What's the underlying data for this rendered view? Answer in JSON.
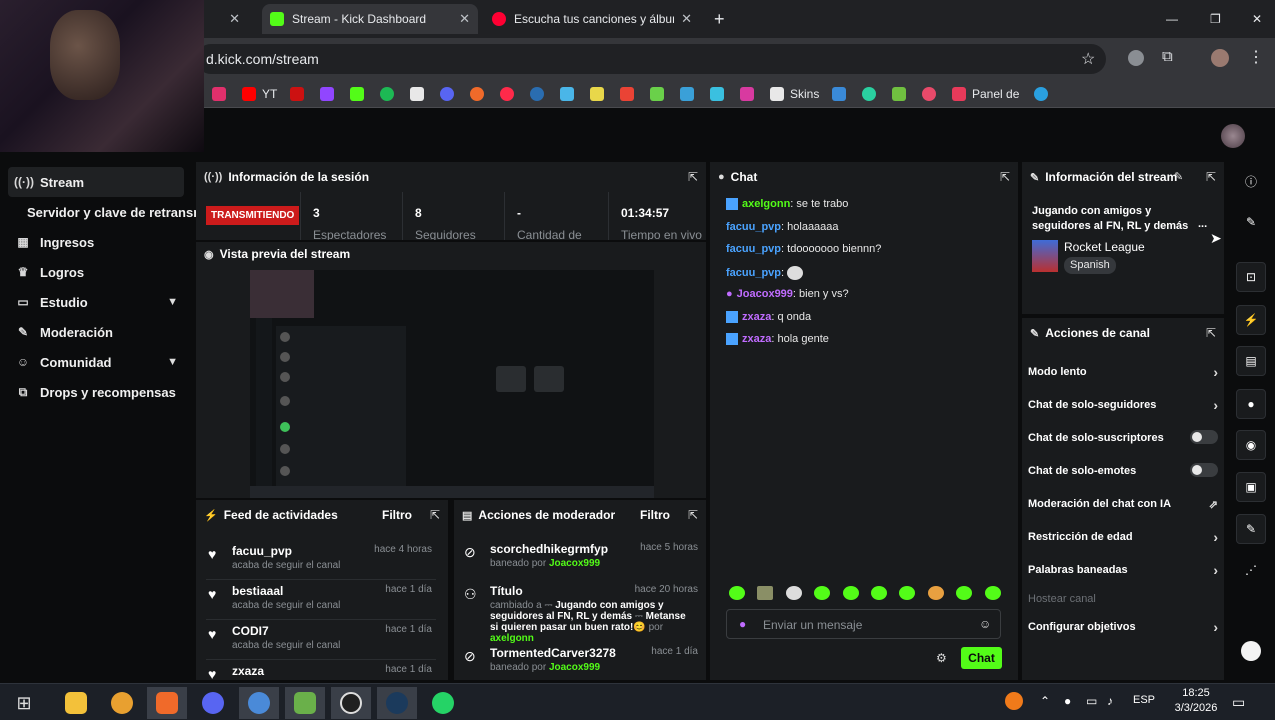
{
  "browser": {
    "tabs": [
      {
        "label": "Stream - Kick Dashboard"
      },
      {
        "label": "Escucha tus canciones y álbume"
      }
    ],
    "url": "d.kick.com/stream",
    "bookmarks": [
      "YT",
      "Skins",
      "Panel de"
    ]
  },
  "sidebar": {
    "items": [
      {
        "label": "Stream",
        "icon": "broadcast-icon"
      },
      {
        "label": "Servidor y clave de retransmisión",
        "icon": ""
      },
      {
        "label": "Ingresos",
        "icon": "chart-icon"
      },
      {
        "label": "Logros",
        "icon": "trophy-icon"
      },
      {
        "label": "Estudio",
        "icon": "studio-icon"
      },
      {
        "label": "Moderación",
        "icon": "wrench-icon"
      },
      {
        "label": "Comunidad",
        "icon": "community-icon"
      },
      {
        "label": "Drops y recompensas",
        "icon": "drops-icon"
      }
    ]
  },
  "session": {
    "title": "Información de la sesión",
    "status": "TRANSMITIENDO",
    "stats": [
      {
        "value": "3",
        "label": "Espectadores"
      },
      {
        "value": "8",
        "label": "Seguidores"
      },
      {
        "value": "-",
        "label": "Cantidad de"
      },
      {
        "value": "01:34:57",
        "label": "Tiempo en vivo"
      }
    ]
  },
  "preview": {
    "title": "Vista previa del stream"
  },
  "chat": {
    "title": "Chat",
    "messages": [
      {
        "user": "axelgonn",
        "text": "se te trabo",
        "color": "#53fc18"
      },
      {
        "user": "facuu_pvp",
        "text": "holaaaaaa",
        "color": "#4aa3ff"
      },
      {
        "user": "facuu_pvp",
        "text": "tdooooooo biennn?",
        "color": "#4aa3ff"
      },
      {
        "user": "facuu_pvp",
        "text": "",
        "color": "#4aa3ff"
      },
      {
        "user": "Joacox999",
        "text": "bien y vs?",
        "color": "#c06cff"
      },
      {
        "user": "zxaza",
        "text": "q onda",
        "color": "#c06cff"
      },
      {
        "user": "zxaza",
        "text": "hola gente",
        "color": "#c06cff"
      }
    ],
    "placeholder": "Enviar un mensaje",
    "send_label": "Chat"
  },
  "feed": {
    "title": "Feed de actividades",
    "filter": "Filtro",
    "items": [
      {
        "name": "facuu_pvp",
        "sub": "acaba de seguir el canal",
        "time": "hace 4 horas"
      },
      {
        "name": "bestiaaal",
        "sub": "acaba de seguir el canal",
        "time": "hace 1 día"
      },
      {
        "name": "CODI7",
        "sub": "acaba de seguir el canal",
        "time": "hace 1 día"
      },
      {
        "name": "zxaza",
        "sub": "",
        "time": "hace 1 día"
      }
    ]
  },
  "modactions": {
    "title": "Acciones de moderador",
    "filter": "Filtro",
    "items": [
      {
        "name": "scorchedhikegrmfyp",
        "sub_prefix": "baneado por",
        "by": "Joacox999",
        "time": "hace 5 horas"
      },
      {
        "name": "Título",
        "sub_prefix": "cambiado a",
        "detail": "Jugando con amigos y seguidores al FN, RL y demás",
        "detail2": "Metanse si quieren pasar un buen rato!😊",
        "by_prefix": "por",
        "by": "axelgonn",
        "time": "hace 20 horas"
      },
      {
        "name": "TormentedCarver3278",
        "sub_prefix": "baneado por",
        "by": "Joacox999",
        "time": "hace 1 día"
      }
    ]
  },
  "streaminfo": {
    "title": "Información del stream",
    "stream_title": "Jugando con amigos y seguidores al FN, RL y demás",
    "ellipsis": "...",
    "game": "Rocket League",
    "language": "Spanish"
  },
  "channel": {
    "title": "Acciones de canal",
    "actions": [
      {
        "label": "Modo lento",
        "kind": "arrow"
      },
      {
        "label": "Chat de solo-seguidores",
        "kind": "arrow"
      },
      {
        "label": "Chat de solo-suscriptores",
        "kind": "toggle"
      },
      {
        "label": "Chat de solo-emotes",
        "kind": "toggle"
      },
      {
        "label": "Moderación del chat con IA",
        "kind": "external"
      },
      {
        "label": "Restricción de edad",
        "kind": "arrow"
      },
      {
        "label": "Palabras baneadas",
        "kind": "arrow"
      },
      {
        "label": "Hostear canal",
        "kind": "disabled"
      },
      {
        "label": "Configurar objetivos",
        "kind": "arrow"
      }
    ]
  },
  "taskbar": {
    "lang": "ESP",
    "time": "18:25",
    "date": "3/3/2026"
  },
  "colors": {
    "accent": "#53fc18",
    "live": "#cc1b1b",
    "panel": "#191b1d",
    "bg": "#0b0c0d"
  }
}
